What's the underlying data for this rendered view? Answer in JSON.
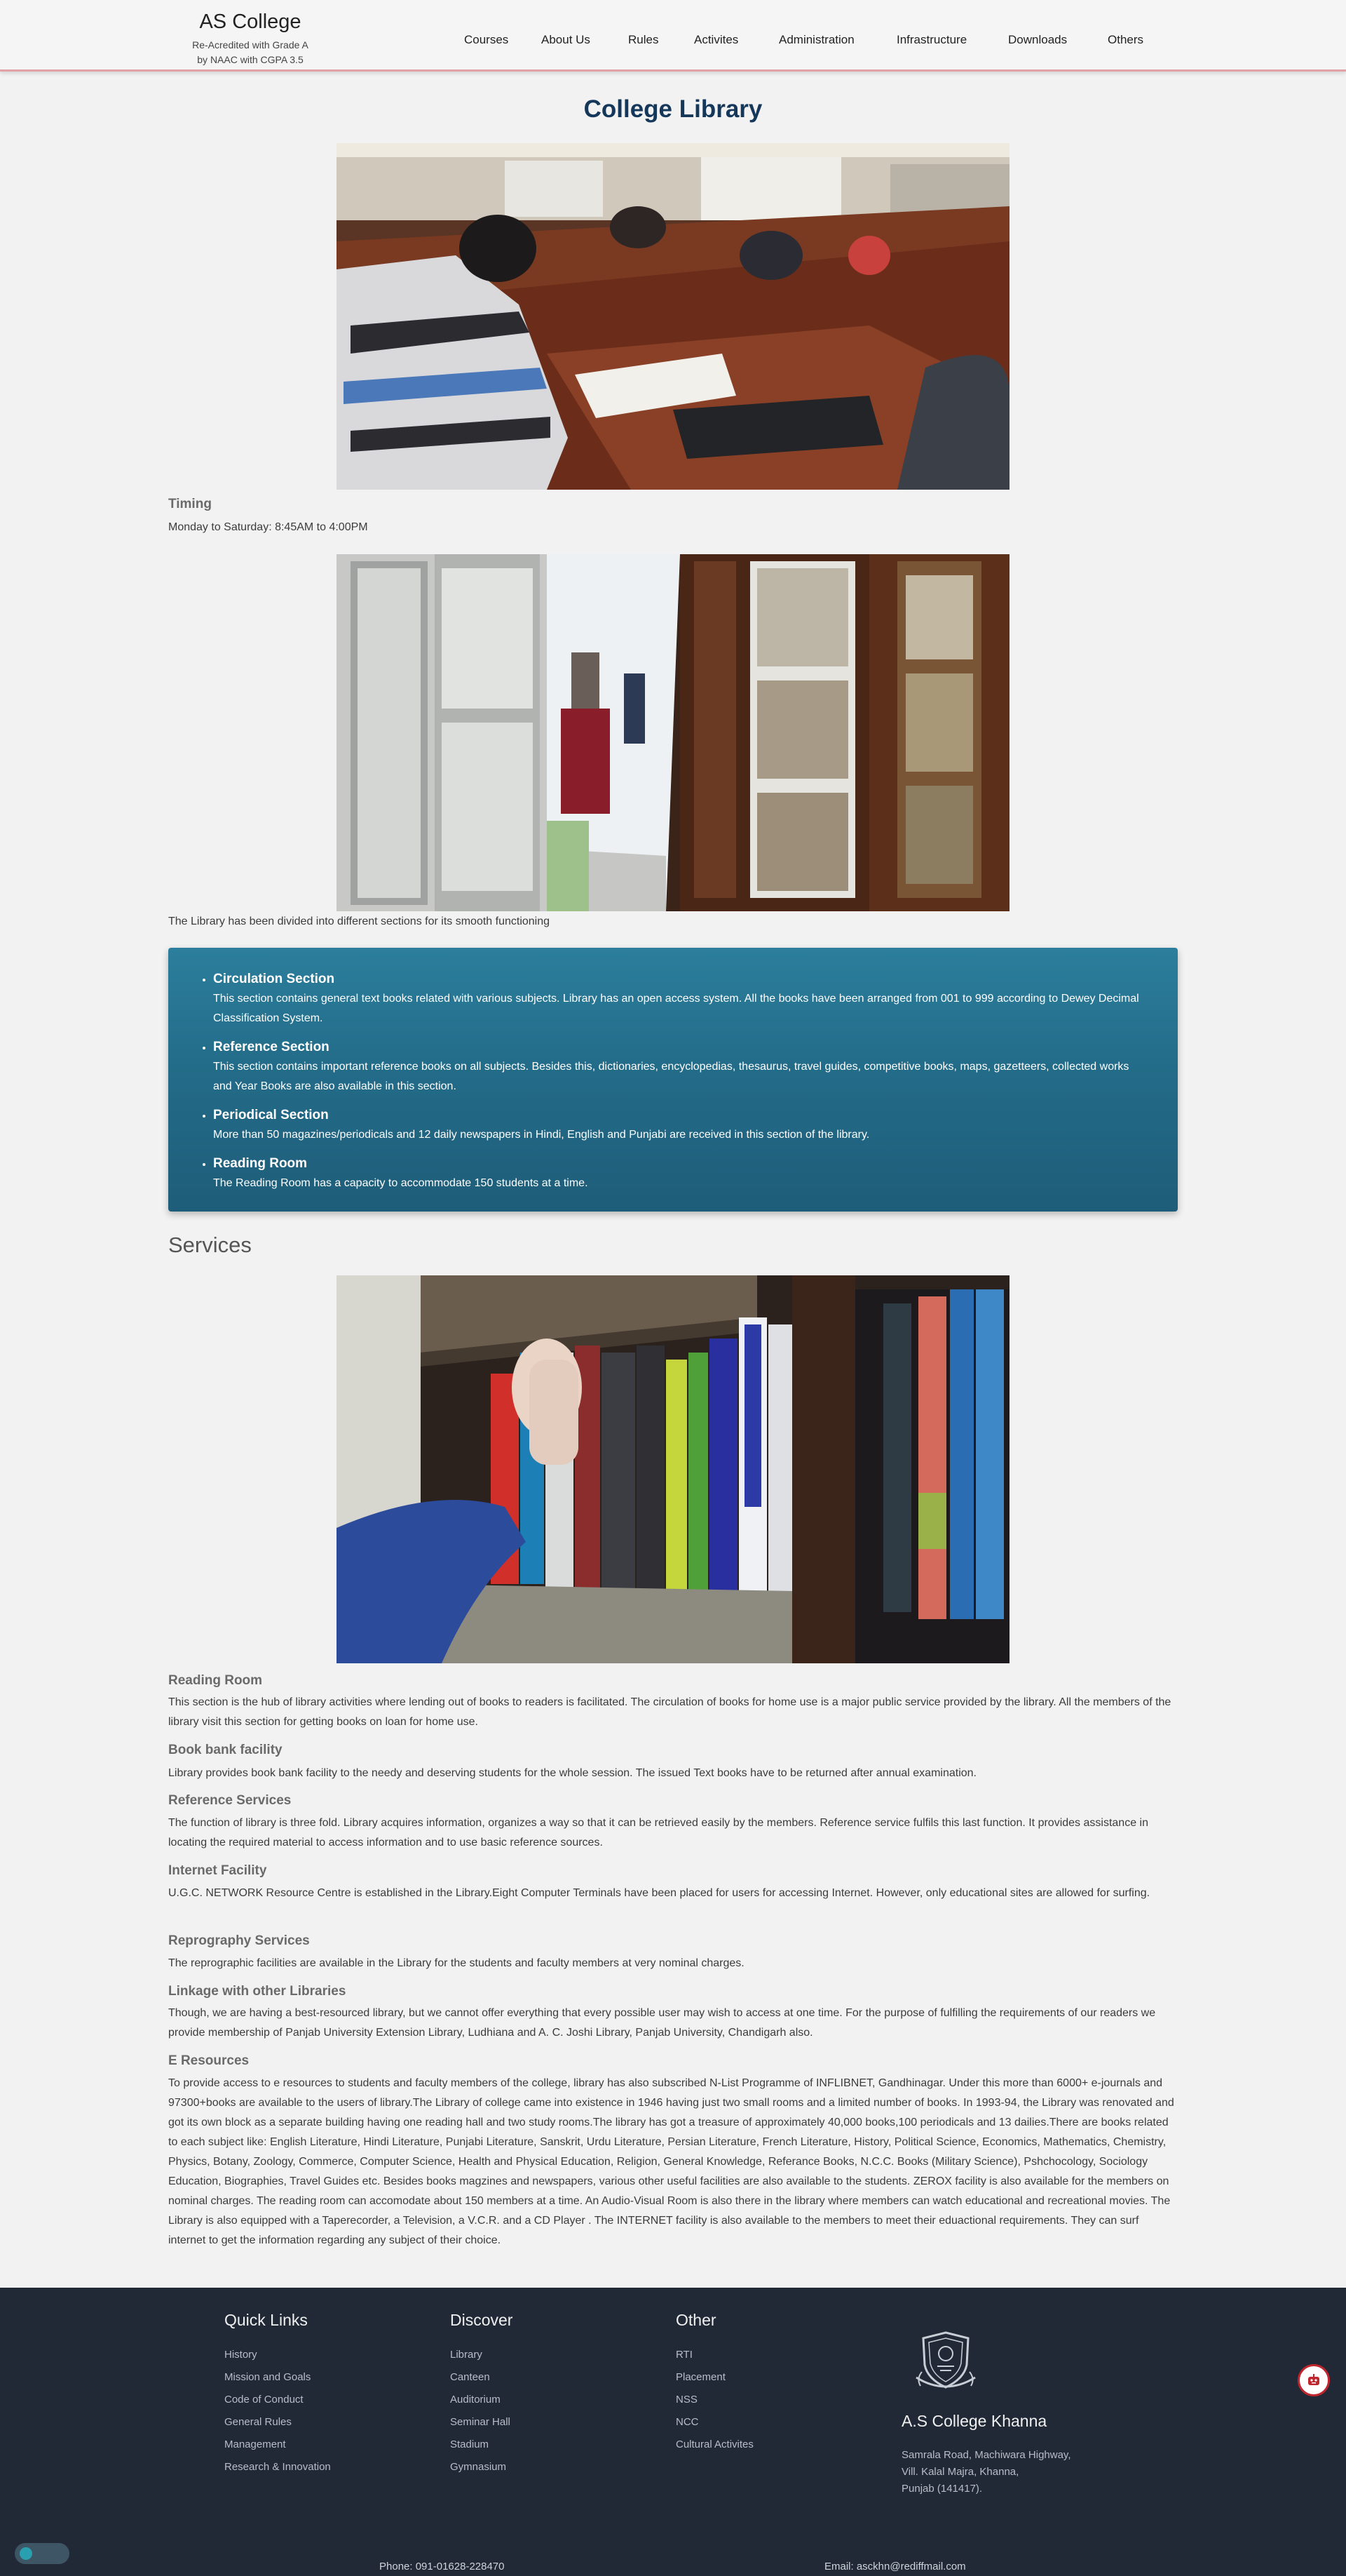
{
  "brand": {
    "name": "AS College",
    "sub1": "Re-Acredited with Grade A",
    "sub2": "by NAAC with CGPA 3.5"
  },
  "nav": [
    "Courses",
    "About Us",
    "Rules",
    "Activites",
    "Administration",
    "Infrastructure",
    "Downloads",
    "Others"
  ],
  "page_title": "College Library",
  "timing": {
    "label": "Timing",
    "text": "Monday to Saturday: 8:45AM to 4:00PM"
  },
  "sections_intro": "The Library has been divided into different sections for its smooth functioning",
  "sections": [
    {
      "title": "Circulation Section",
      "body": "This section contains general text books related with various subjects. Library has an open access system. All the books have been arranged from 001 to 999 according to Dewey Decimal Classification System."
    },
    {
      "title": "Reference Section",
      "body": "This section contains important reference books on all subjects. Besides this, dictionaries, encyclopedias, thesaurus, travel guides, competitive books, maps, gazetteers, collected works and Year Books are also available in this section."
    },
    {
      "title": "Periodical Section",
      "body": "More than 50 magazines/periodicals and 12 daily newspapers in Hindi, English and Punjabi are received in this section of the library."
    },
    {
      "title": "Reading Room",
      "body": "The Reading Room has a capacity to accommodate 150 students at a time."
    }
  ],
  "services_title": "Services",
  "services": [
    {
      "title": "Reading Room",
      "body": "This section is the hub of library activities where lending out of books to readers is facilitated. The circulation of books for home use is a major public service provided by the library. All the members of the library visit this section for getting books on loan for home use."
    },
    {
      "title": "Book bank facility",
      "body": "Library provides book bank facility to the needy and deserving students for the whole session. The issued Text books have to be returned after annual examination."
    },
    {
      "title": "Reference Services",
      "body": "The function of library is three fold. Library acquires information, organizes a way so that it can be retrieved easily by the members. Reference service fulfils this last function. It provides assistance in locating the required material to access information and to use basic reference sources."
    },
    {
      "title": "Internet Facility",
      "body": "U.G.C. NETWORK Resource Centre is established in the Library.Eight Computer Terminals have been placed for users for accessing Internet. However, only educational sites are allowed for surfing."
    },
    {
      "title": "Reprography Services",
      "body": "The reprographic facilities are available in the Library for the students and faculty members at very nominal charges."
    },
    {
      "title": "Linkage with other Libraries",
      "body": "Though, we are having a best-resourced library, but we cannot offer everything that every possible user may wish to access at one time. For the purpose of fulfilling the requirements of our readers we provide membership of Panjab University Extension Library, Ludhiana and A. C. Joshi Library, Panjab University, Chandigarh also."
    },
    {
      "title": "E Resources",
      "body": "To provide access to e resources to students and faculty members of the college, library has also subscribed N-List Programme of INFLIBNET, Gandhinagar. Under this more than 6000+ e-journals and 97300+books are available to the users of library.The Library of college came into existence in 1946 having just two small rooms and a limited number of books. In 1993-94, the Library was renovated and got its own block as a separate building having one reading hall and two study rooms.The library has got a treasure of approximately 40,000 books,100 periodicals and 13 dailies.There are books related to each subject like: English Literature, Hindi Literature, Punjabi Literature, Sanskrit, Urdu Literature, Persian Literature, French Literature, History, Political Science, Economics, Mathematics, Chemistry, Physics, Botany, Zoology, Commerce, Computer Science, Health and Physical Education, Religion, General Knowledge, Referance Books, N.C.C. Books (Military Science), Pshchocology, Sociology Education, Biographies, Travel Guides etc. Besides books magzines and newspapers, various other useful facilities are also available to the students. ZEROX facility is also available for the members on nominal charges. The reading room can accomodate about 150 members at a time. An Audio-Visual Room is also there in the library where members can watch educational and recreational movies. The Library is also equipped with a Taperecorder, a Television, a V.C.R. and a CD Player . The INTERNET facility is also available to the members to meet their eduactional requirements. They can surf internet to get the information regarding any subject of their choice."
    }
  ],
  "footer": {
    "quick_links_title": "Quick Links",
    "quick_links": [
      "History",
      "Mission and Goals",
      "Code of Conduct",
      "General Rules",
      "Management",
      "Research & Innovation"
    ],
    "discover_title": "Discover",
    "discover": [
      "Library",
      "Canteen",
      "Auditorium",
      "Seminar Hall",
      "Stadium",
      "Gymnasium"
    ],
    "other_title": "Other",
    "other": [
      "RTI",
      "Placement",
      "NSS",
      "NCC",
      "Cultural Activites"
    ],
    "college_name": "A.S College Khanna",
    "address": [
      "Samrala Road, Machiwara Highway,",
      "Vill. Kalal Majra, Khanna,",
      "Punjab (141417)."
    ],
    "phone": "Phone: 091-01628-228470",
    "email": "Email: asckhn@rediffmail.com"
  },
  "colors": {
    "title": "#14375a",
    "sections_box": "#236c89",
    "footer_bg": "#212936",
    "header_border": "#e3a2a8"
  }
}
